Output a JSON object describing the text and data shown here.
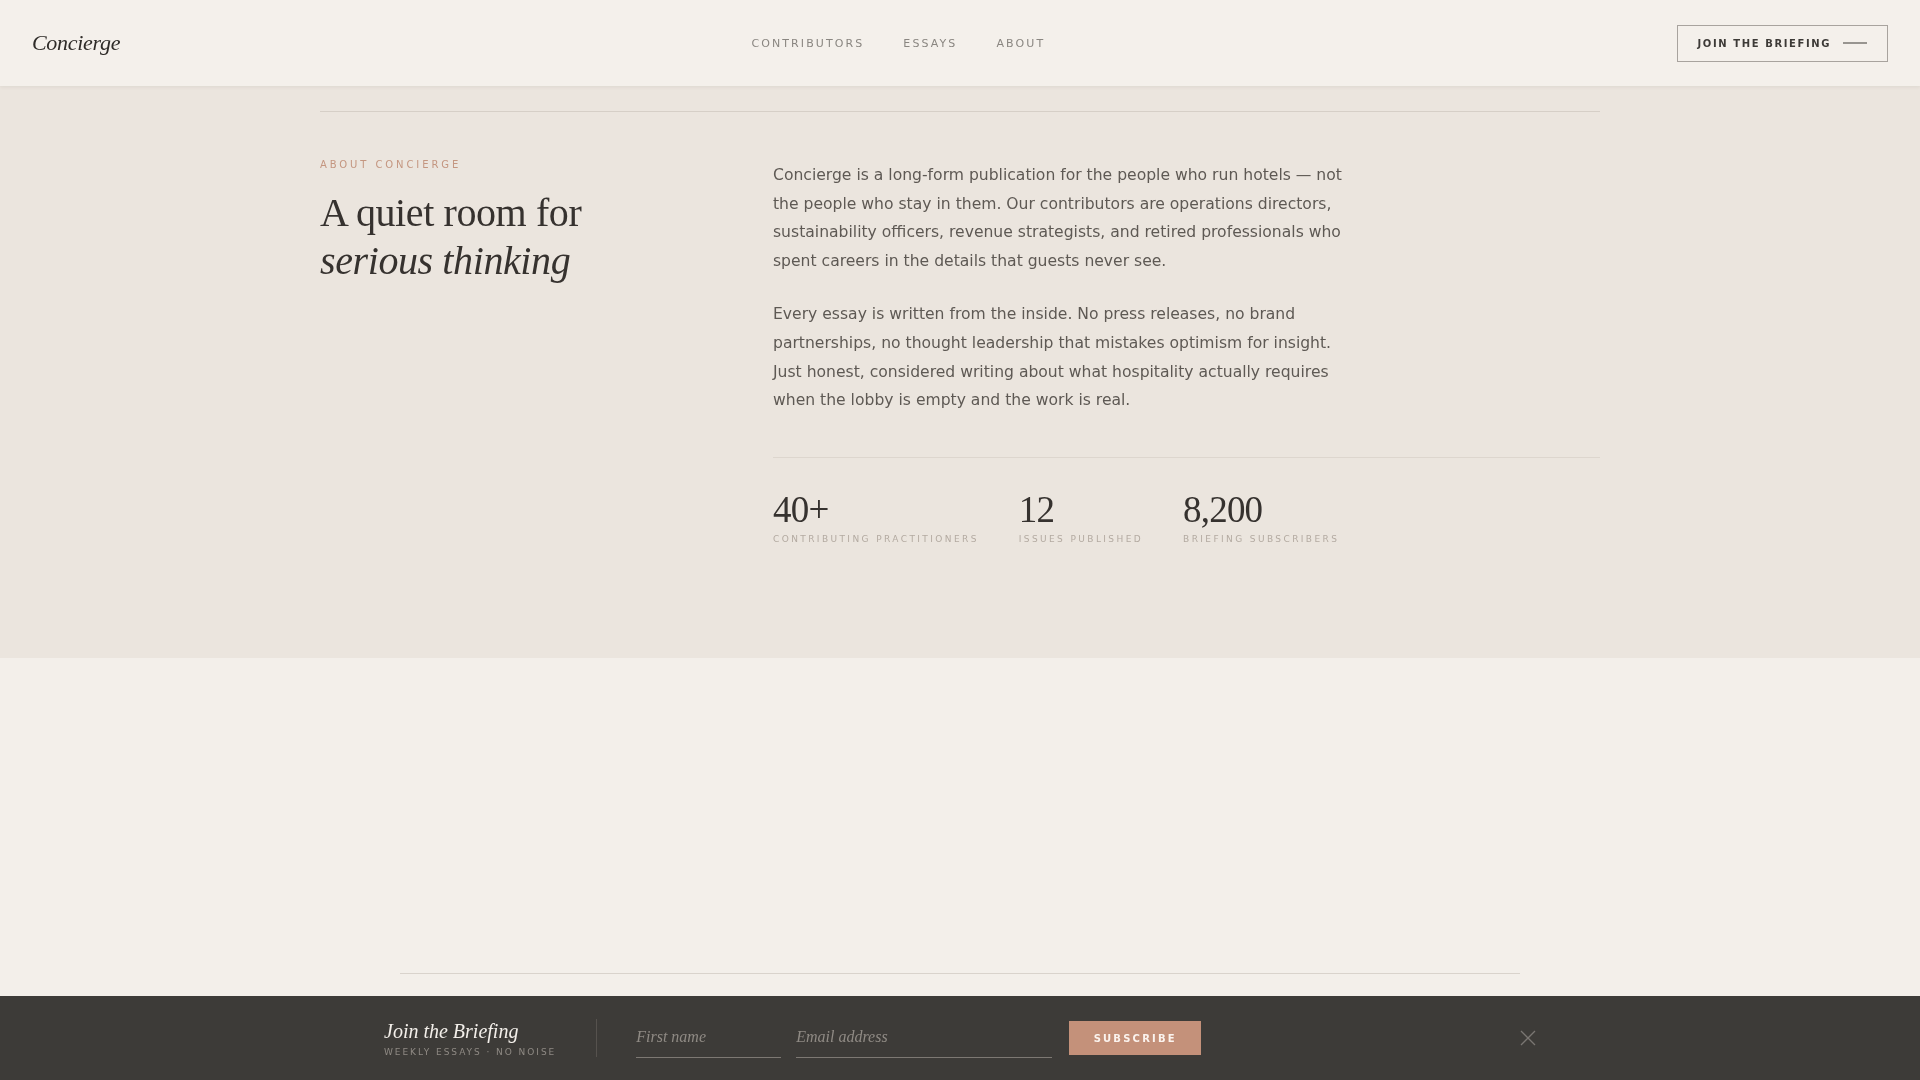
{
  "header": {
    "logo": "Concierge",
    "nav": [
      {
        "label": "CONTRIBUTORS"
      },
      {
        "label": "ESSAYS"
      },
      {
        "label": "ABOUT"
      }
    ],
    "cta": "JOIN THE BRIEFING"
  },
  "about": {
    "eyebrow": "ABOUT CONCIERGE",
    "heading": "A quiet room for *serious thinking*",
    "paragraphs": [
      "Concierge is a long-form publication for the people who run hotels — not the people who stay in them. Our contributors are operations directors, sustainability officers, revenue strategists, and retired professionals who spent careers in the details that guests never see.",
      "Every essay is written from the inside. No press releases, no brand partnerships, no thought leadership that mistakes optimism for insight. Just honest, considered writing about what hospitality actually requires when the lobby is empty and the work is real."
    ],
    "stats": [
      {
        "value": "40+",
        "label": "CONTRIBUTING PRACTITIONERS"
      },
      {
        "value": "12",
        "label": "ISSUES PUBLISHED"
      },
      {
        "value": "8,200",
        "label": "BRIEFING SUBSCRIBERS"
      }
    ]
  },
  "briefing_bar": {
    "title": "Join the Briefing",
    "subtitle": "WEEKLY ESSAYS · NO NOISE",
    "fields": [
      {
        "placeholder": "First name"
      },
      {
        "placeholder": "Email address"
      }
    ],
    "button": "SUBSCRIBE"
  }
}
